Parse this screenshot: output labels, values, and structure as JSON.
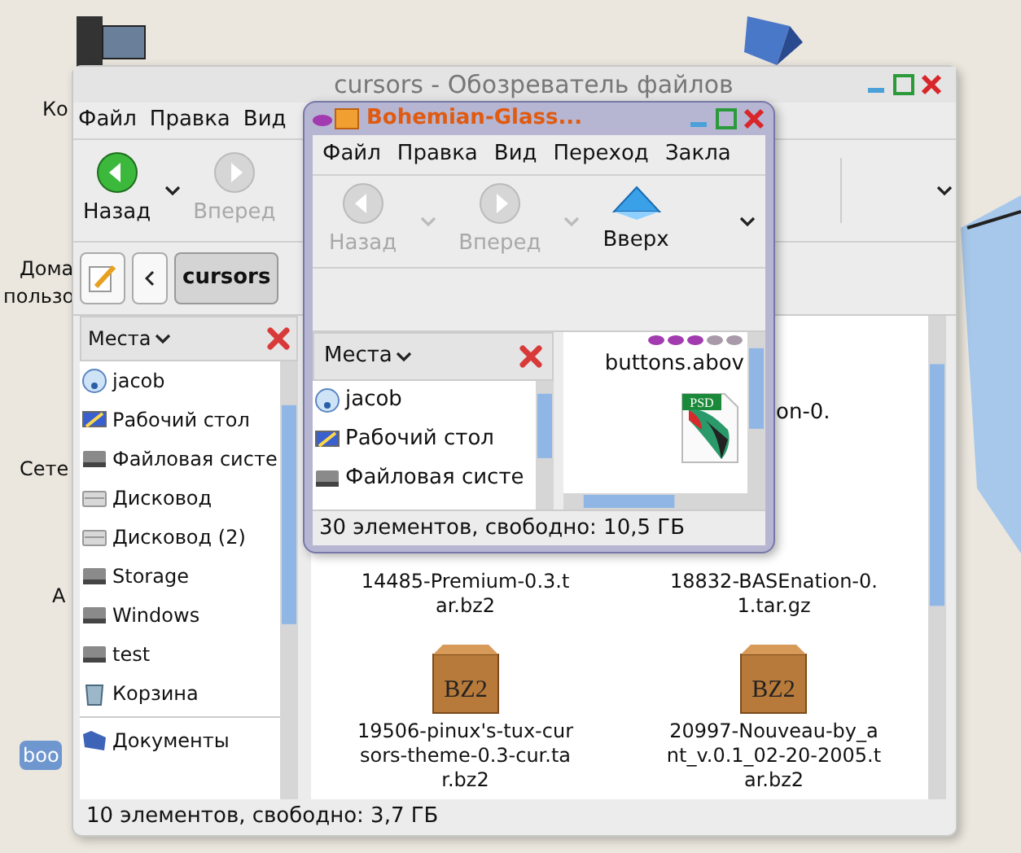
{
  "desktop": {
    "labels": [
      {
        "text": "Ко",
        "selected": false
      },
      {
        "text": "Дома",
        "selected": false
      },
      {
        "text": "пользо",
        "selected": false
      },
      {
        "text": "Сете",
        "selected": false
      },
      {
        "text": "А",
        "selected": false
      },
      {
        "text": "boo",
        "selected": true
      }
    ]
  },
  "back_window": {
    "title": "cursors - Обозреватель файлов",
    "menu": [
      "Файл",
      "Правка",
      "Вид"
    ],
    "toolbar": [
      {
        "kind": "back",
        "label": "Назад",
        "disabled": false
      },
      {
        "kind": "forward",
        "label": "Вперед",
        "disabled": true
      }
    ],
    "path": [
      {
        "label": "cursors",
        "selected": true
      }
    ],
    "places_label": "Места",
    "places": [
      {
        "kind": "home",
        "label": "jacob"
      },
      {
        "kind": "desktop",
        "label": "Рабочий стол"
      },
      {
        "kind": "drive",
        "label": "Файловая систе"
      },
      {
        "kind": "removable",
        "label": "Дисковод"
      },
      {
        "kind": "removable",
        "label": "Дисковод (2)"
      },
      {
        "kind": "drive",
        "label": "Storage"
      },
      {
        "kind": "drive",
        "label": "Windows"
      },
      {
        "kind": "drive",
        "label": "test"
      },
      {
        "kind": "trash",
        "label": "Корзина"
      }
    ],
    "bookmarks": [
      {
        "kind": "folder",
        "label": "Документы"
      }
    ],
    "files": [
      {
        "kind": "fragment",
        "name": "on-0."
      },
      {
        "kind": "plain",
        "name": "14485-Premium-0.3.tar.bz2"
      },
      {
        "kind": "plain",
        "name": "18832-BASEnation-0.1.tar.gz"
      },
      {
        "kind": "bz2",
        "icon_text": "BZ2",
        "name": "19506-pinux's-tux-cursors-theme-0.3-cur.tar.bz2"
      },
      {
        "kind": "bz2",
        "icon_text": "BZ2",
        "name": "20997-Nouveau-by_ant_v.0.1_02-20-2005.tar.bz2"
      }
    ],
    "status": "10 элементов, свободно: 3,7 ГБ"
  },
  "front_window": {
    "title": "Bohemian-Glass...",
    "menu": [
      "Файл",
      "Правка",
      "Вид",
      "Переход",
      "Закла"
    ],
    "toolbar": [
      {
        "kind": "back",
        "label": "Назад",
        "disabled": true
      },
      {
        "kind": "forward",
        "label": "Вперед",
        "disabled": true
      },
      {
        "kind": "up",
        "label": "Вверх",
        "disabled": false
      }
    ],
    "places_label": "Места",
    "places": [
      {
        "kind": "home",
        "label": "jacob"
      },
      {
        "kind": "desktop",
        "label": "Рабочий стол"
      },
      {
        "kind": "drive",
        "label": "Файловая систе"
      }
    ],
    "files": [
      {
        "kind": "buttons",
        "name": "buttons.abov"
      },
      {
        "kind": "psd",
        "icon_text": "PSD"
      }
    ],
    "status": "30 элементов, свободно: 10,5 ГБ"
  }
}
